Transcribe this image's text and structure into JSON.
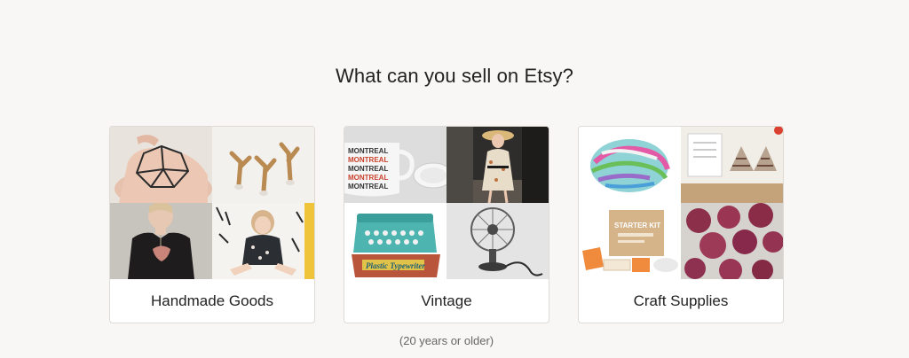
{
  "section": {
    "title": "What can you sell on Etsy?"
  },
  "cards": [
    {
      "label": "Handmade Goods",
      "tiles": [
        "geometric-glass-terrarium-image",
        "wooden-wall-hooks-image",
        "printed-tank-top-image",
        "child-print-dress-image"
      ]
    },
    {
      "label": "Vintage",
      "tiles": [
        "montreal-mugs-image",
        "woman-vintage-dress-image",
        "toy-typewriter-image",
        "vintage-desk-fan-image"
      ]
    },
    {
      "label": "Craft Supplies",
      "tiles": [
        "yarn-skein-image",
        "knitting-pattern-image",
        "starter-kit-box-image",
        "felt-balls-image"
      ]
    }
  ],
  "vintage_note": "(20 years or older)"
}
